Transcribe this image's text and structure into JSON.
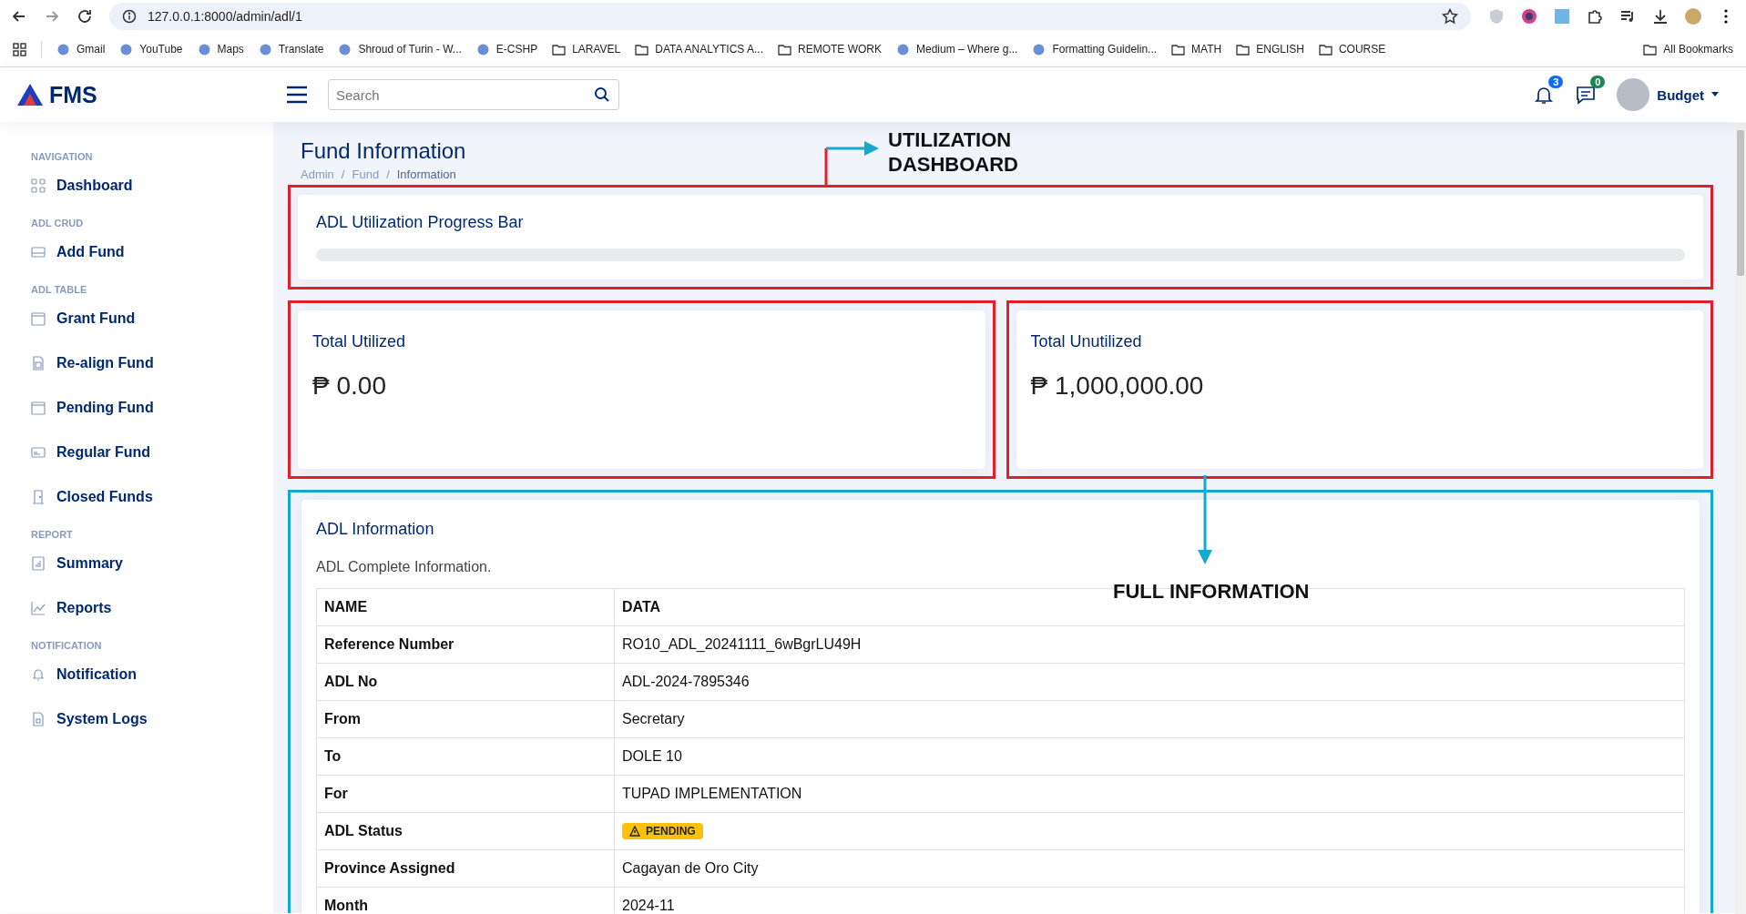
{
  "browser": {
    "address": "127.0.0.1:8000/admin/adl/1",
    "bookmarks": [
      {
        "label": "Gmail",
        "kind": "site"
      },
      {
        "label": "YouTube",
        "kind": "site"
      },
      {
        "label": "Maps",
        "kind": "site"
      },
      {
        "label": "Translate",
        "kind": "site"
      },
      {
        "label": "Shroud of Turin - W...",
        "kind": "site"
      },
      {
        "label": "E-CSHP",
        "kind": "site"
      },
      {
        "label": "LARAVEL",
        "kind": "folder"
      },
      {
        "label": "DATA ANALYTICS A...",
        "kind": "folder"
      },
      {
        "label": "REMOTE WORK",
        "kind": "folder"
      },
      {
        "label": "Medium – Where g...",
        "kind": "site"
      },
      {
        "label": "Formatting Guidelin...",
        "kind": "site"
      },
      {
        "label": "MATH",
        "kind": "folder"
      },
      {
        "label": "ENGLISH",
        "kind": "folder"
      },
      {
        "label": "COURSE",
        "kind": "folder"
      }
    ],
    "all_bookmarks": "All Bookmarks"
  },
  "header": {
    "logo": "FMS",
    "search": {
      "placeholder": "Search"
    },
    "notifications_badge": "3",
    "messages_badge": "0",
    "user": "Budget"
  },
  "sidebar": {
    "sections": [
      {
        "heading": "NAVIGATION",
        "items": [
          {
            "label": "Dashboard",
            "selected": false
          }
        ]
      },
      {
        "heading": "ADL CRUD",
        "items": [
          {
            "label": "Add Fund",
            "selected": false
          }
        ]
      },
      {
        "heading": "ADL TABLE",
        "items": [
          {
            "label": "Grant Fund",
            "selected": false
          },
          {
            "label": "Re-align Fund",
            "selected": false
          },
          {
            "label": "Pending Fund",
            "selected": false
          },
          {
            "label": "Regular Fund",
            "selected": false
          },
          {
            "label": "Closed Funds",
            "selected": false
          }
        ]
      },
      {
        "heading": "REPORT",
        "items": [
          {
            "label": "Summary",
            "selected": false
          },
          {
            "label": "Reports",
            "selected": false
          }
        ]
      },
      {
        "heading": "NOTIFICATION",
        "items": [
          {
            "label": "Notification",
            "selected": false
          },
          {
            "label": "System Logs",
            "selected": false
          }
        ]
      }
    ]
  },
  "page": {
    "title": "Fund Information",
    "breadcrumbs": [
      "Admin",
      "Fund",
      "Information"
    ],
    "breadcrumb_separator": "/"
  },
  "progress": {
    "title": "ADL Utilization Progress Bar",
    "level": 0
  },
  "stats": [
    {
      "title": "Total Utilized",
      "value": "₱ 0.00"
    },
    {
      "title": "Total Unutilized",
      "value": "₱ 1,000,000.00"
    }
  ],
  "info": {
    "title": "ADL Information",
    "subtitle": "ADL Complete Information.",
    "columns": [
      "NAME",
      "DATA"
    ],
    "rows": [
      {
        "name": "Reference Number",
        "data": "RO10_ADL_20241111_6wBgrLU49H",
        "kind": "text"
      },
      {
        "name": "ADL No",
        "data": "ADL-2024-7895346",
        "kind": "text"
      },
      {
        "name": "From",
        "data": "Secretary",
        "kind": "text"
      },
      {
        "name": "To",
        "data": "DOLE 10",
        "kind": "text"
      },
      {
        "name": "For",
        "data": "TUPAD IMPLEMENTATION",
        "kind": "text"
      },
      {
        "name": "ADL Status",
        "data": "PENDING",
        "kind": "badge"
      },
      {
        "name": "Province Assigned",
        "data": "Cagayan de Oro City",
        "kind": "text"
      },
      {
        "name": "Month",
        "data": "2024-11",
        "kind": "text"
      }
    ]
  },
  "annotations": [
    {
      "text": "UTILIZATION DASHBOARD"
    },
    {
      "text": "FULL INFORMATION"
    }
  ]
}
